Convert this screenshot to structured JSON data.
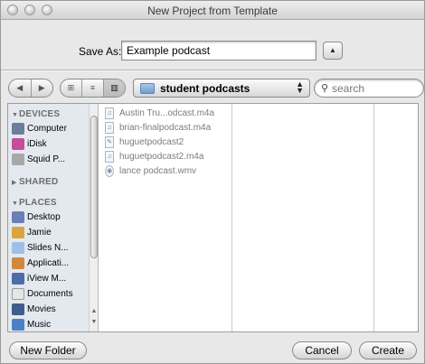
{
  "window": {
    "title": "New Project from Template"
  },
  "save_as": {
    "label": "Save As:",
    "value": "Example podcast",
    "expand_glyph": "▲"
  },
  "toolbar": {
    "nav": {
      "back": "◀",
      "forward": "▶"
    },
    "views": {
      "icon": "⊞",
      "list": "≡",
      "column": "▥",
      "selected": "column"
    },
    "folder_popup": {
      "label": "student podcasts",
      "arrows": "▲▼"
    },
    "search": {
      "placeholder": "search",
      "icon": "search-icon"
    }
  },
  "sidebar": {
    "devices": {
      "label": "DEVICES",
      "items": [
        {
          "label": "Computer",
          "icon": "computer-icon",
          "color": "#6b7f99"
        },
        {
          "label": "iDisk",
          "icon": "idisk-icon",
          "color": "#c64d9a"
        },
        {
          "label": "Squid P...",
          "icon": "drive-icon",
          "color": "#a8a8a8"
        }
      ]
    },
    "shared": {
      "label": "SHARED"
    },
    "places": {
      "label": "PLACES",
      "items": [
        {
          "label": "Desktop",
          "icon": "desktop-icon",
          "color": "#6a7fb8"
        },
        {
          "label": "Jamie",
          "icon": "home-icon",
          "color": "#d9a441"
        },
        {
          "label": "Slides N...",
          "icon": "folder-icon",
          "color": "#9cc0e6"
        },
        {
          "label": "Applicati...",
          "icon": "applications-icon",
          "color": "#d0883a"
        },
        {
          "label": "iView M...",
          "icon": "iview-icon",
          "color": "#4b6ea8"
        },
        {
          "label": "Documents",
          "icon": "documents-icon",
          "color": "#e6e6e6"
        },
        {
          "label": "Movies",
          "icon": "movies-icon",
          "color": "#3f5d8c"
        },
        {
          "label": "Music",
          "icon": "music-icon",
          "color": "#4d7fc4"
        }
      ]
    }
  },
  "files": [
    {
      "name": "Austin Tru...odcast.m4a",
      "icon": "audio-file-icon",
      "glyph": "♫"
    },
    {
      "name": "brian-finalpodcast.m4a",
      "icon": "audio-file-icon",
      "glyph": "♫"
    },
    {
      "name": "huguetpodcast2",
      "icon": "document-icon",
      "glyph": "✎"
    },
    {
      "name": "huguetpodcast2.m4a",
      "icon": "audio-file-icon",
      "glyph": "♫"
    },
    {
      "name": "lance podcast.wmv",
      "icon": "video-file-icon",
      "glyph": "◉"
    }
  ],
  "buttons": {
    "new_folder": "New Folder",
    "cancel": "Cancel",
    "create": "Create"
  }
}
